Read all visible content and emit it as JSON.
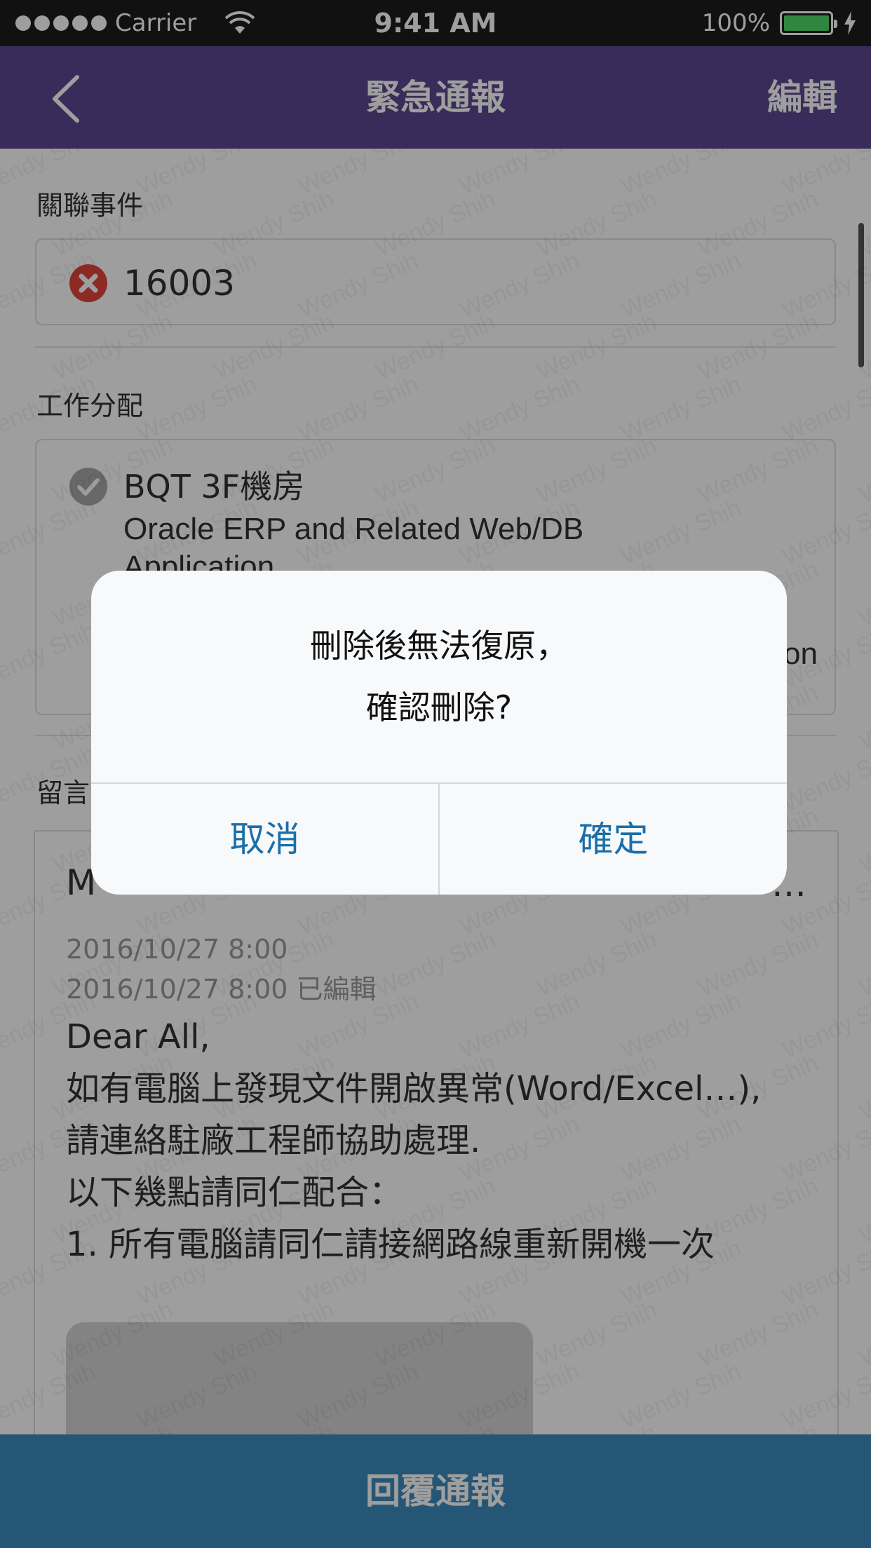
{
  "status_bar": {
    "carrier": "Carrier",
    "time": "9:41 AM",
    "battery_percent": "100%",
    "battery_level": 1.0
  },
  "nav": {
    "title": "緊急通報",
    "edit_label": "編輯",
    "back_icon": "chevron-left-icon"
  },
  "related_event": {
    "label": "關聯事件",
    "value": "16003",
    "icon": "remove-circle-icon",
    "icon_color": "#e5453a"
  },
  "assignment": {
    "label": "工作分配",
    "name": "BQT 3F機房",
    "description": "Oracle ERP and Related Web/DB Application",
    "tail": "on",
    "icon": "checkmark-circle-icon"
  },
  "messages": {
    "label": "留言",
    "author": "M",
    "more": "…",
    "created": "2016/10/27 8:00",
    "edited": "2016/10/27 8:00",
    "edited_tag": "已編輯",
    "body": [
      "Dear All,",
      "如有電腦上發現文件開啟異常(Word/Excel…),",
      "請連絡駐廠工程師協助處理.",
      "以下幾點請同仁配合：",
      "1. 所有電腦請同仁請接網路線重新開機一次"
    ]
  },
  "watermark_text": "Wendy Shih",
  "bottom_bar": {
    "label": "回覆通報"
  },
  "dialog": {
    "line1": "刪除後無法復原，",
    "line2": "確認刪除?",
    "cancel_label": "取消",
    "confirm_label": "確定"
  },
  "colors": {
    "nav_bg": "#5c4791",
    "bottom_bar_bg": "#3e8bbf",
    "dialog_button_text": "#1a6fa8"
  }
}
